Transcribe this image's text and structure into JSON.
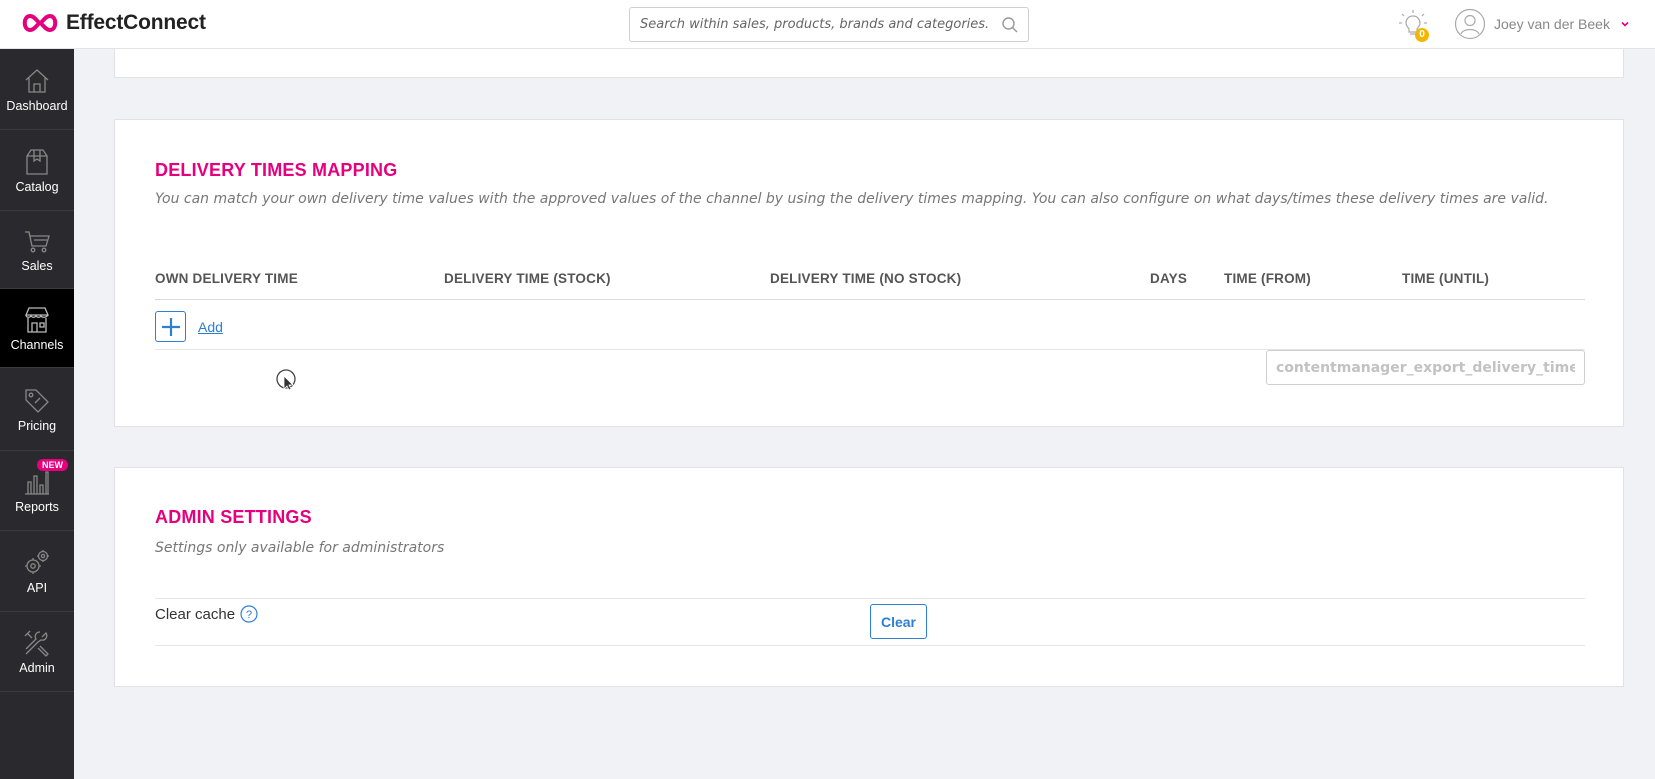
{
  "app": {
    "name": "EffectConnect"
  },
  "header": {
    "search_placeholder": "Search within sales, products, brands and categories...",
    "notification_count": "0",
    "user_name": "Joey van der Beek"
  },
  "sidebar": {
    "items": [
      {
        "label": "Dashboard",
        "icon": "home-icon"
      },
      {
        "label": "Catalog",
        "icon": "box-icon"
      },
      {
        "label": "Sales",
        "icon": "cart-icon"
      },
      {
        "label": "Channels",
        "icon": "store-icon",
        "active": true
      },
      {
        "label": "Pricing",
        "icon": "price-tag-icon"
      },
      {
        "label": "Reports",
        "icon": "bar-chart-icon",
        "badge": "NEW"
      },
      {
        "label": "API",
        "icon": "gears-icon"
      },
      {
        "label": "Admin",
        "icon": "tools-icon"
      }
    ]
  },
  "delivery": {
    "title": "DELIVERY TIMES MAPPING",
    "description": "You can match your own delivery time values with the approved values of the channel by using the delivery times mapping. You can also configure on what days/times these delivery times are valid.",
    "columns": [
      "OWN DELIVERY TIME",
      "DELIVERY TIME (STOCK)",
      "DELIVERY TIME (NO STOCK)",
      "DAYS",
      "TIME (FROM)",
      "TIME (UNTIL)"
    ],
    "add_label": "Add",
    "save_key_value": "contentmanager_export_delivery_time_save"
  },
  "admin": {
    "title": "ADMIN SETTINGS",
    "description": "Settings only available for administrators",
    "clear_cache_label": "Clear cache",
    "clear_button": "Clear"
  },
  "colors": {
    "accent": "#e6007e",
    "link": "#2d7fd3",
    "sidebar": "#2a2a2e"
  }
}
